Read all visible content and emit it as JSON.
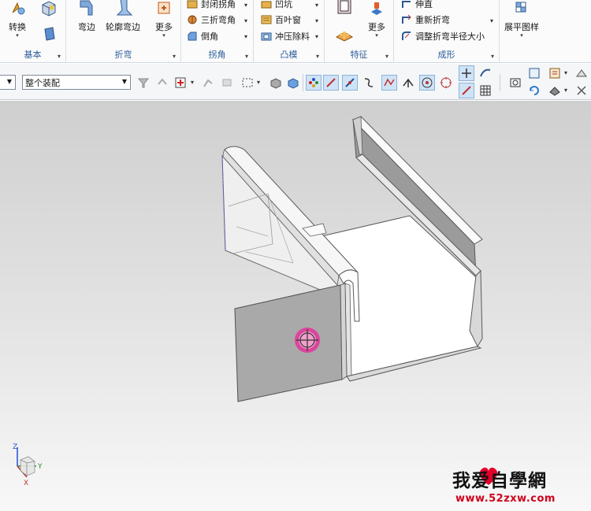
{
  "ribbon": {
    "groups": [
      {
        "label": "基本",
        "buttons": [
          "转换"
        ]
      },
      {
        "label": "折弯",
        "buttons": [
          "弯边",
          "轮廓弯边",
          "更多"
        ]
      },
      {
        "label": "拐角",
        "items": [
          "封闭拐角",
          "三折弯角",
          "倒角"
        ]
      },
      {
        "label": "凸模",
        "items": [
          "凹坑",
          "百叶窗",
          "冲压除料"
        ]
      },
      {
        "label": "特征",
        "buttons": [
          "更多"
        ]
      },
      {
        "label": "成形",
        "items": [
          "伸直",
          "重新折弯",
          "调整折弯半径大小"
        ]
      },
      {
        "label": "",
        "buttons": [
          "展平图样"
        ]
      }
    ]
  },
  "toolbar": {
    "filter_value": "",
    "scope_value": "整个装配"
  },
  "watermark": {
    "main": "我爱自學網",
    "url": "www.52zxw.com"
  },
  "triad": {
    "z": "Z",
    "y": "Y",
    "x": "X"
  },
  "colors": {
    "accent": "#2a5d9a",
    "watermark_red": "#d0021b",
    "heart": "#e4002b"
  }
}
